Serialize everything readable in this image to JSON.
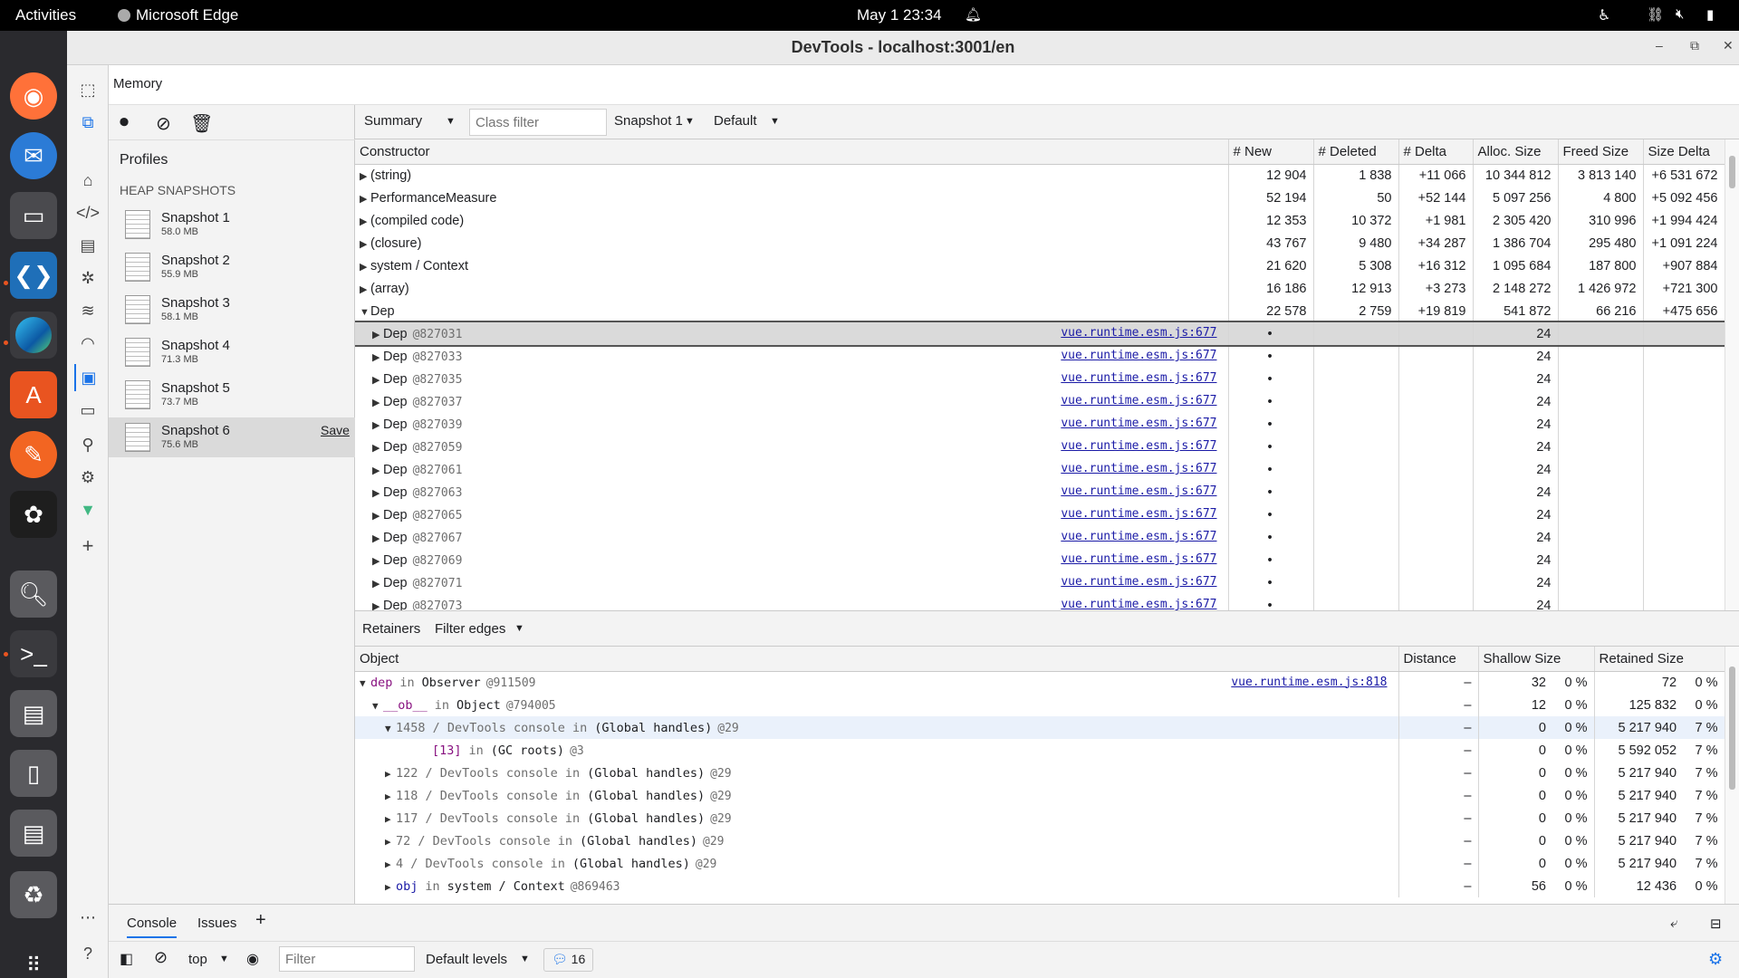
{
  "topbar": {
    "activities": "Activities",
    "app": "Microsoft Edge",
    "clock": "May 1  23:34"
  },
  "window": {
    "title": "DevTools - localhost:3001/en"
  },
  "panel": {
    "title": "Memory"
  },
  "sidebar": {
    "profiles_label": "Profiles",
    "section_label": "HEAP SNAPSHOTS",
    "save_label": "Save",
    "snapshots": [
      {
        "name": "Snapshot 1",
        "size": "58.0 MB"
      },
      {
        "name": "Snapshot 2",
        "size": "55.9 MB"
      },
      {
        "name": "Snapshot 3",
        "size": "58.1 MB"
      },
      {
        "name": "Snapshot 4",
        "size": "71.3 MB"
      },
      {
        "name": "Snapshot 5",
        "size": "73.7 MB"
      },
      {
        "name": "Snapshot 6",
        "size": "75.6 MB"
      }
    ]
  },
  "toolbar": {
    "view": "Summary",
    "class_filter_placeholder": "Class filter",
    "snapshot": "Snapshot 1",
    "mode": "Default"
  },
  "summary": {
    "columns": [
      "Constructor",
      "# New",
      "# Deleted",
      "# Delta",
      "Alloc. Size",
      "Freed Size",
      "Size Delta"
    ],
    "groups": [
      {
        "name": "(string)",
        "new": "12 904",
        "deleted": "1 838",
        "delta": "+11 066",
        "alloc": "10 344 812",
        "freed": "3 813 140",
        "size_delta": "+6 531 672"
      },
      {
        "name": "PerformanceMeasure",
        "new": "52 194",
        "deleted": "50",
        "delta": "+52 144",
        "alloc": "5 097 256",
        "freed": "4 800",
        "size_delta": "+5 092 456"
      },
      {
        "name": "(compiled code)",
        "new": "12 353",
        "deleted": "10 372",
        "delta": "+1 981",
        "alloc": "2 305 420",
        "freed": "310 996",
        "size_delta": "+1 994 424"
      },
      {
        "name": "(closure)",
        "new": "43 767",
        "deleted": "9 480",
        "delta": "+34 287",
        "alloc": "1 386 704",
        "freed": "295 480",
        "size_delta": "+1 091 224"
      },
      {
        "name": "system / Context",
        "new": "21 620",
        "deleted": "5 308",
        "delta": "+16 312",
        "alloc": "1 095 684",
        "freed": "187 800",
        "size_delta": "+907 884"
      },
      {
        "name": "(array)",
        "new": "16 186",
        "deleted": "12 913",
        "delta": "+3 273",
        "alloc": "2 148 272",
        "freed": "1 426 972",
        "size_delta": "+721 300"
      },
      {
        "name": "Dep",
        "new": "22 578",
        "deleted": "2 759",
        "delta": "+19 819",
        "alloc": "541 872",
        "freed": "66 216",
        "size_delta": "+475 656"
      }
    ],
    "dep_children": [
      {
        "name": "Dep",
        "id": "@827031",
        "src": "vue.runtime.esm.js:677",
        "new": "•",
        "alloc": "24"
      },
      {
        "name": "Dep",
        "id": "@827033",
        "src": "vue.runtime.esm.js:677",
        "new": "•",
        "alloc": "24"
      },
      {
        "name": "Dep",
        "id": "@827035",
        "src": "vue.runtime.esm.js:677",
        "new": "•",
        "alloc": "24"
      },
      {
        "name": "Dep",
        "id": "@827037",
        "src": "vue.runtime.esm.js:677",
        "new": "•",
        "alloc": "24"
      },
      {
        "name": "Dep",
        "id": "@827039",
        "src": "vue.runtime.esm.js:677",
        "new": "•",
        "alloc": "24"
      },
      {
        "name": "Dep",
        "id": "@827059",
        "src": "vue.runtime.esm.js:677",
        "new": "•",
        "alloc": "24"
      },
      {
        "name": "Dep",
        "id": "@827061",
        "src": "vue.runtime.esm.js:677",
        "new": "•",
        "alloc": "24"
      },
      {
        "name": "Dep",
        "id": "@827063",
        "src": "vue.runtime.esm.js:677",
        "new": "•",
        "alloc": "24"
      },
      {
        "name": "Dep",
        "id": "@827065",
        "src": "vue.runtime.esm.js:677",
        "new": "•",
        "alloc": "24"
      },
      {
        "name": "Dep",
        "id": "@827067",
        "src": "vue.runtime.esm.js:677",
        "new": "•",
        "alloc": "24"
      },
      {
        "name": "Dep",
        "id": "@827069",
        "src": "vue.runtime.esm.js:677",
        "new": "•",
        "alloc": "24"
      },
      {
        "name": "Dep",
        "id": "@827071",
        "src": "vue.runtime.esm.js:677",
        "new": "•",
        "alloc": "24"
      },
      {
        "name": "Dep",
        "id": "@827073",
        "src": "vue.runtime.esm.js:677",
        "new": "•",
        "alloc": "24"
      }
    ]
  },
  "retainers": {
    "tab": "Retainers",
    "filter": "Filter edges",
    "columns": [
      "Object",
      "Distance",
      "Shallow Size",
      "Retained Size"
    ],
    "rows": [
      {
        "indent": 0,
        "tri": "down",
        "name": "dep",
        "in": "in",
        "ctx": "Observer",
        "id": "@911509",
        "src": "vue.runtime.esm.js:818",
        "dist": "–",
        "shallow": "32",
        "shallow_pct": "0 %",
        "retained": "72",
        "retained_pct": "0 %"
      },
      {
        "indent": 1,
        "tri": "down",
        "name": "__ob__",
        "in": "in",
        "ctx": "Object",
        "id": "@794005",
        "src": "",
        "dist": "–",
        "shallow": "12",
        "shallow_pct": "0 %",
        "retained": "125 832",
        "retained_pct": "0 %"
      },
      {
        "indent": 2,
        "tri": "down",
        "name": "1458 / DevTools console",
        "in": "in",
        "ctx": "(Global handles)",
        "id": "@29",
        "src": "",
        "dist": "–",
        "shallow": "0",
        "shallow_pct": "0 %",
        "retained": "5 217 940",
        "retained_pct": "7 %"
      },
      {
        "indent": 3,
        "tri": "",
        "name": "[13]",
        "in": "in",
        "ctx": "(GC roots)",
        "id": "@3",
        "src": "",
        "dist": "–",
        "shallow": "0",
        "shallow_pct": "0 %",
        "retained": "5 592 052",
        "retained_pct": "7 %"
      },
      {
        "indent": 2,
        "tri": "right",
        "name": "122 / DevTools console",
        "in": "in",
        "ctx": "(Global handles)",
        "id": "@29",
        "src": "",
        "dist": "–",
        "shallow": "0",
        "shallow_pct": "0 %",
        "retained": "5 217 940",
        "retained_pct": "7 %"
      },
      {
        "indent": 2,
        "tri": "right",
        "name": "118 / DevTools console",
        "in": "in",
        "ctx": "(Global handles)",
        "id": "@29",
        "src": "",
        "dist": "–",
        "shallow": "0",
        "shallow_pct": "0 %",
        "retained": "5 217 940",
        "retained_pct": "7 %"
      },
      {
        "indent": 2,
        "tri": "right",
        "name": "117 / DevTools console",
        "in": "in",
        "ctx": "(Global handles)",
        "id": "@29",
        "src": "",
        "dist": "–",
        "shallow": "0",
        "shallow_pct": "0 %",
        "retained": "5 217 940",
        "retained_pct": "7 %"
      },
      {
        "indent": 2,
        "tri": "right",
        "name": "72 / DevTools console",
        "in": "in",
        "ctx": "(Global handles)",
        "id": "@29",
        "src": "",
        "dist": "–",
        "shallow": "0",
        "shallow_pct": "0 %",
        "retained": "5 217 940",
        "retained_pct": "7 %"
      },
      {
        "indent": 2,
        "tri": "right",
        "name": "4 / DevTools console",
        "in": "in",
        "ctx": "(Global handles)",
        "id": "@29",
        "src": "",
        "dist": "–",
        "shallow": "0",
        "shallow_pct": "0 %",
        "retained": "5 217 940",
        "retained_pct": "7 %"
      },
      {
        "indent": 2,
        "tri": "right",
        "name": "obj",
        "in": "in",
        "ctx": "system / Context",
        "id": "@869463",
        "src": "",
        "dist": "–",
        "shallow": "56",
        "shallow_pct": "0 %",
        "retained": "12 436",
        "retained_pct": "0 %"
      }
    ]
  },
  "drawer": {
    "tabs": [
      "Console",
      "Issues"
    ],
    "context": "top",
    "filter_placeholder": "Filter",
    "levels": "Default levels",
    "message_count": "16"
  }
}
